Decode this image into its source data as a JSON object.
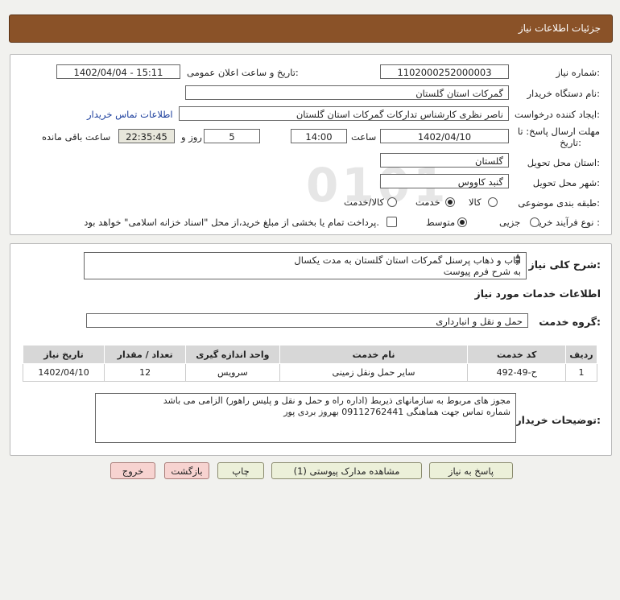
{
  "title": "جزئیات اطلاعات نیاز",
  "info": {
    "need_number_label": "شماره نیاز:",
    "need_number": "1102000252000003",
    "announce_label": "تاریخ و ساعت اعلان عمومی:",
    "announce_value": "1402/04/04 - 15:11",
    "buyer_org_label": "نام دستگاه خریدار:",
    "buyer_org": "گمرکات استان گلستان",
    "creator_label": "ایجاد کننده درخواست:",
    "creator": "ناصر نظری کارشناس تدارکات گمرکات استان گلستان",
    "contact_link": "اطلاعات تماس خریدار",
    "deadline_label_1": "مهلت ارسال پاسخ: تا",
    "deadline_label_2": "تاریخ:",
    "deadline_date": "1402/04/10",
    "time_label": "ساعت",
    "deadline_time": "14:00",
    "days_value": "5",
    "days_label": "روز و",
    "remaining_time": "22:35:45",
    "remaining_label": "ساعت باقی مانده",
    "province_label": "استان محل تحویل:",
    "province": "گلستان",
    "city_label": "شهر محل تحویل:",
    "city": "گنبد کاووس",
    "category_label": "طبقه بندی موضوعی:",
    "category_options": [
      "کالا",
      "خدمت",
      "کالا/خدمت"
    ],
    "category_selected": "خدمت",
    "process_label": "نوع فرآیند خرید :",
    "process_options": [
      "جزیی",
      "متوسط"
    ],
    "process_selected": "متوسط",
    "payment_note": "پرداخت تمام یا بخشی از مبلغ خرید،از محل \"اسناد خزانه اسلامی\" خواهد بود."
  },
  "description": {
    "label": "شرح کلی نیاز:",
    "line1": "ایاب و ذهاب پرسنل گمرکات استان گلستان به مدت یکسال",
    "line2": "به شرح فرم پیوست"
  },
  "services": {
    "section_title": "اطلاعات خدمات مورد نیاز",
    "group_label": "گروه خدمت:",
    "group_value": "حمل و نقل و انبارداری",
    "columns": [
      "ردیف",
      "کد خدمت",
      "نام خدمت",
      "واحد اندازه گیری",
      "تعداد / مقدار",
      "تاریخ نیاز"
    ],
    "rows": [
      [
        "1",
        "ح-49-492",
        "سایر حمل ونقل زمینی",
        "سرویس",
        "12",
        "1402/04/10"
      ]
    ]
  },
  "buyer_notes": {
    "label": "توضیحات خریدار:",
    "line1": "مجوز های مربوط به سازمانهای ذیربط (اداره راه و حمل و نقل و پلیس راهور) الزامی می باشد",
    "line2": "شماره تماس جهت هماهنگی 09112762441 بهروز بردی پور"
  },
  "buttons": {
    "reply": "پاسخ به نیاز",
    "attachments": "مشاهده مدارک پیوستی (1)",
    "print": "چاپ",
    "back": "بازگشت",
    "exit": "خروج"
  },
  "watermark": {
    "brand": "ParsNamadData",
    "persian": "مرکز فراوری اطلاعات پارس نماد داده",
    "phone": "۰۲۱-۸۸۳۴۹۶۷۰-۵"
  }
}
